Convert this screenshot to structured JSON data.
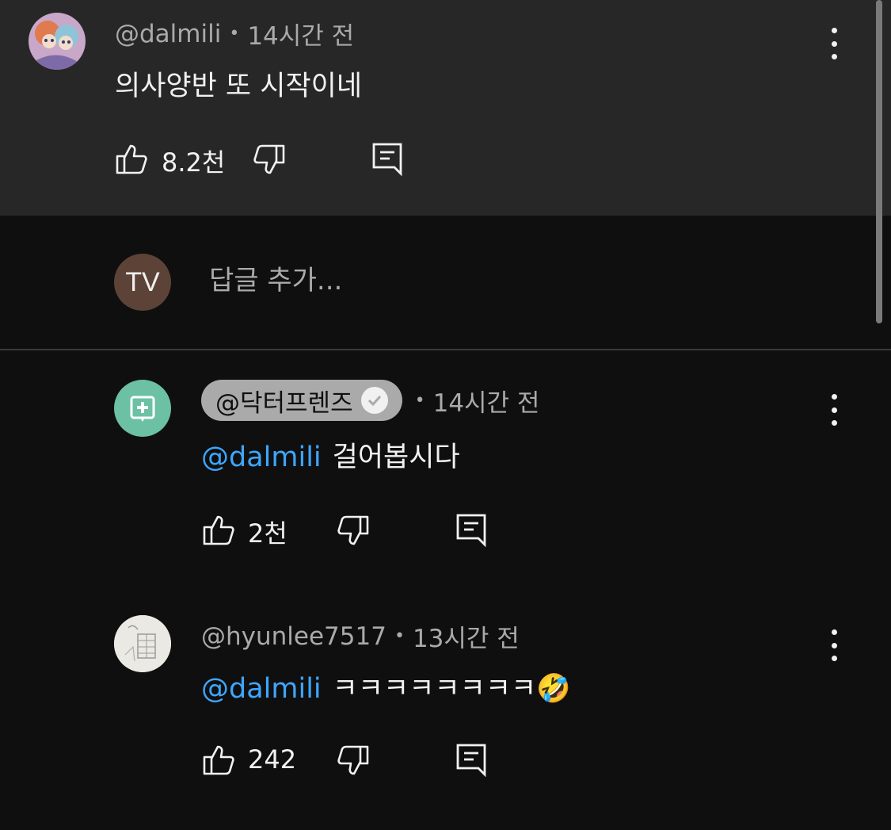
{
  "comments": [
    {
      "handle": "@dalmili",
      "time": "14시간 전",
      "text": "의사양반 또 시작이네",
      "likes": "8.2천"
    },
    {
      "handle": "@닥터프렌즈",
      "time": "14시간 전",
      "mention": "@dalmili",
      "text": "걸어봅시다",
      "likes": "2천"
    },
    {
      "handle": "@hyunlee7517",
      "time": "13시간 전",
      "mention": "@dalmili",
      "text": "ㅋㅋㅋㅋㅋㅋㅋㅋ🤣",
      "likes": "242"
    }
  ],
  "reply": {
    "avatar_initials": "TV",
    "placeholder": "답글 추가..."
  },
  "meta_separator": "•",
  "colors": {
    "background": "#0f0f0f",
    "highlight": "#272727",
    "mention": "#3ea6ff",
    "secondary_text": "#aaaaaa"
  }
}
